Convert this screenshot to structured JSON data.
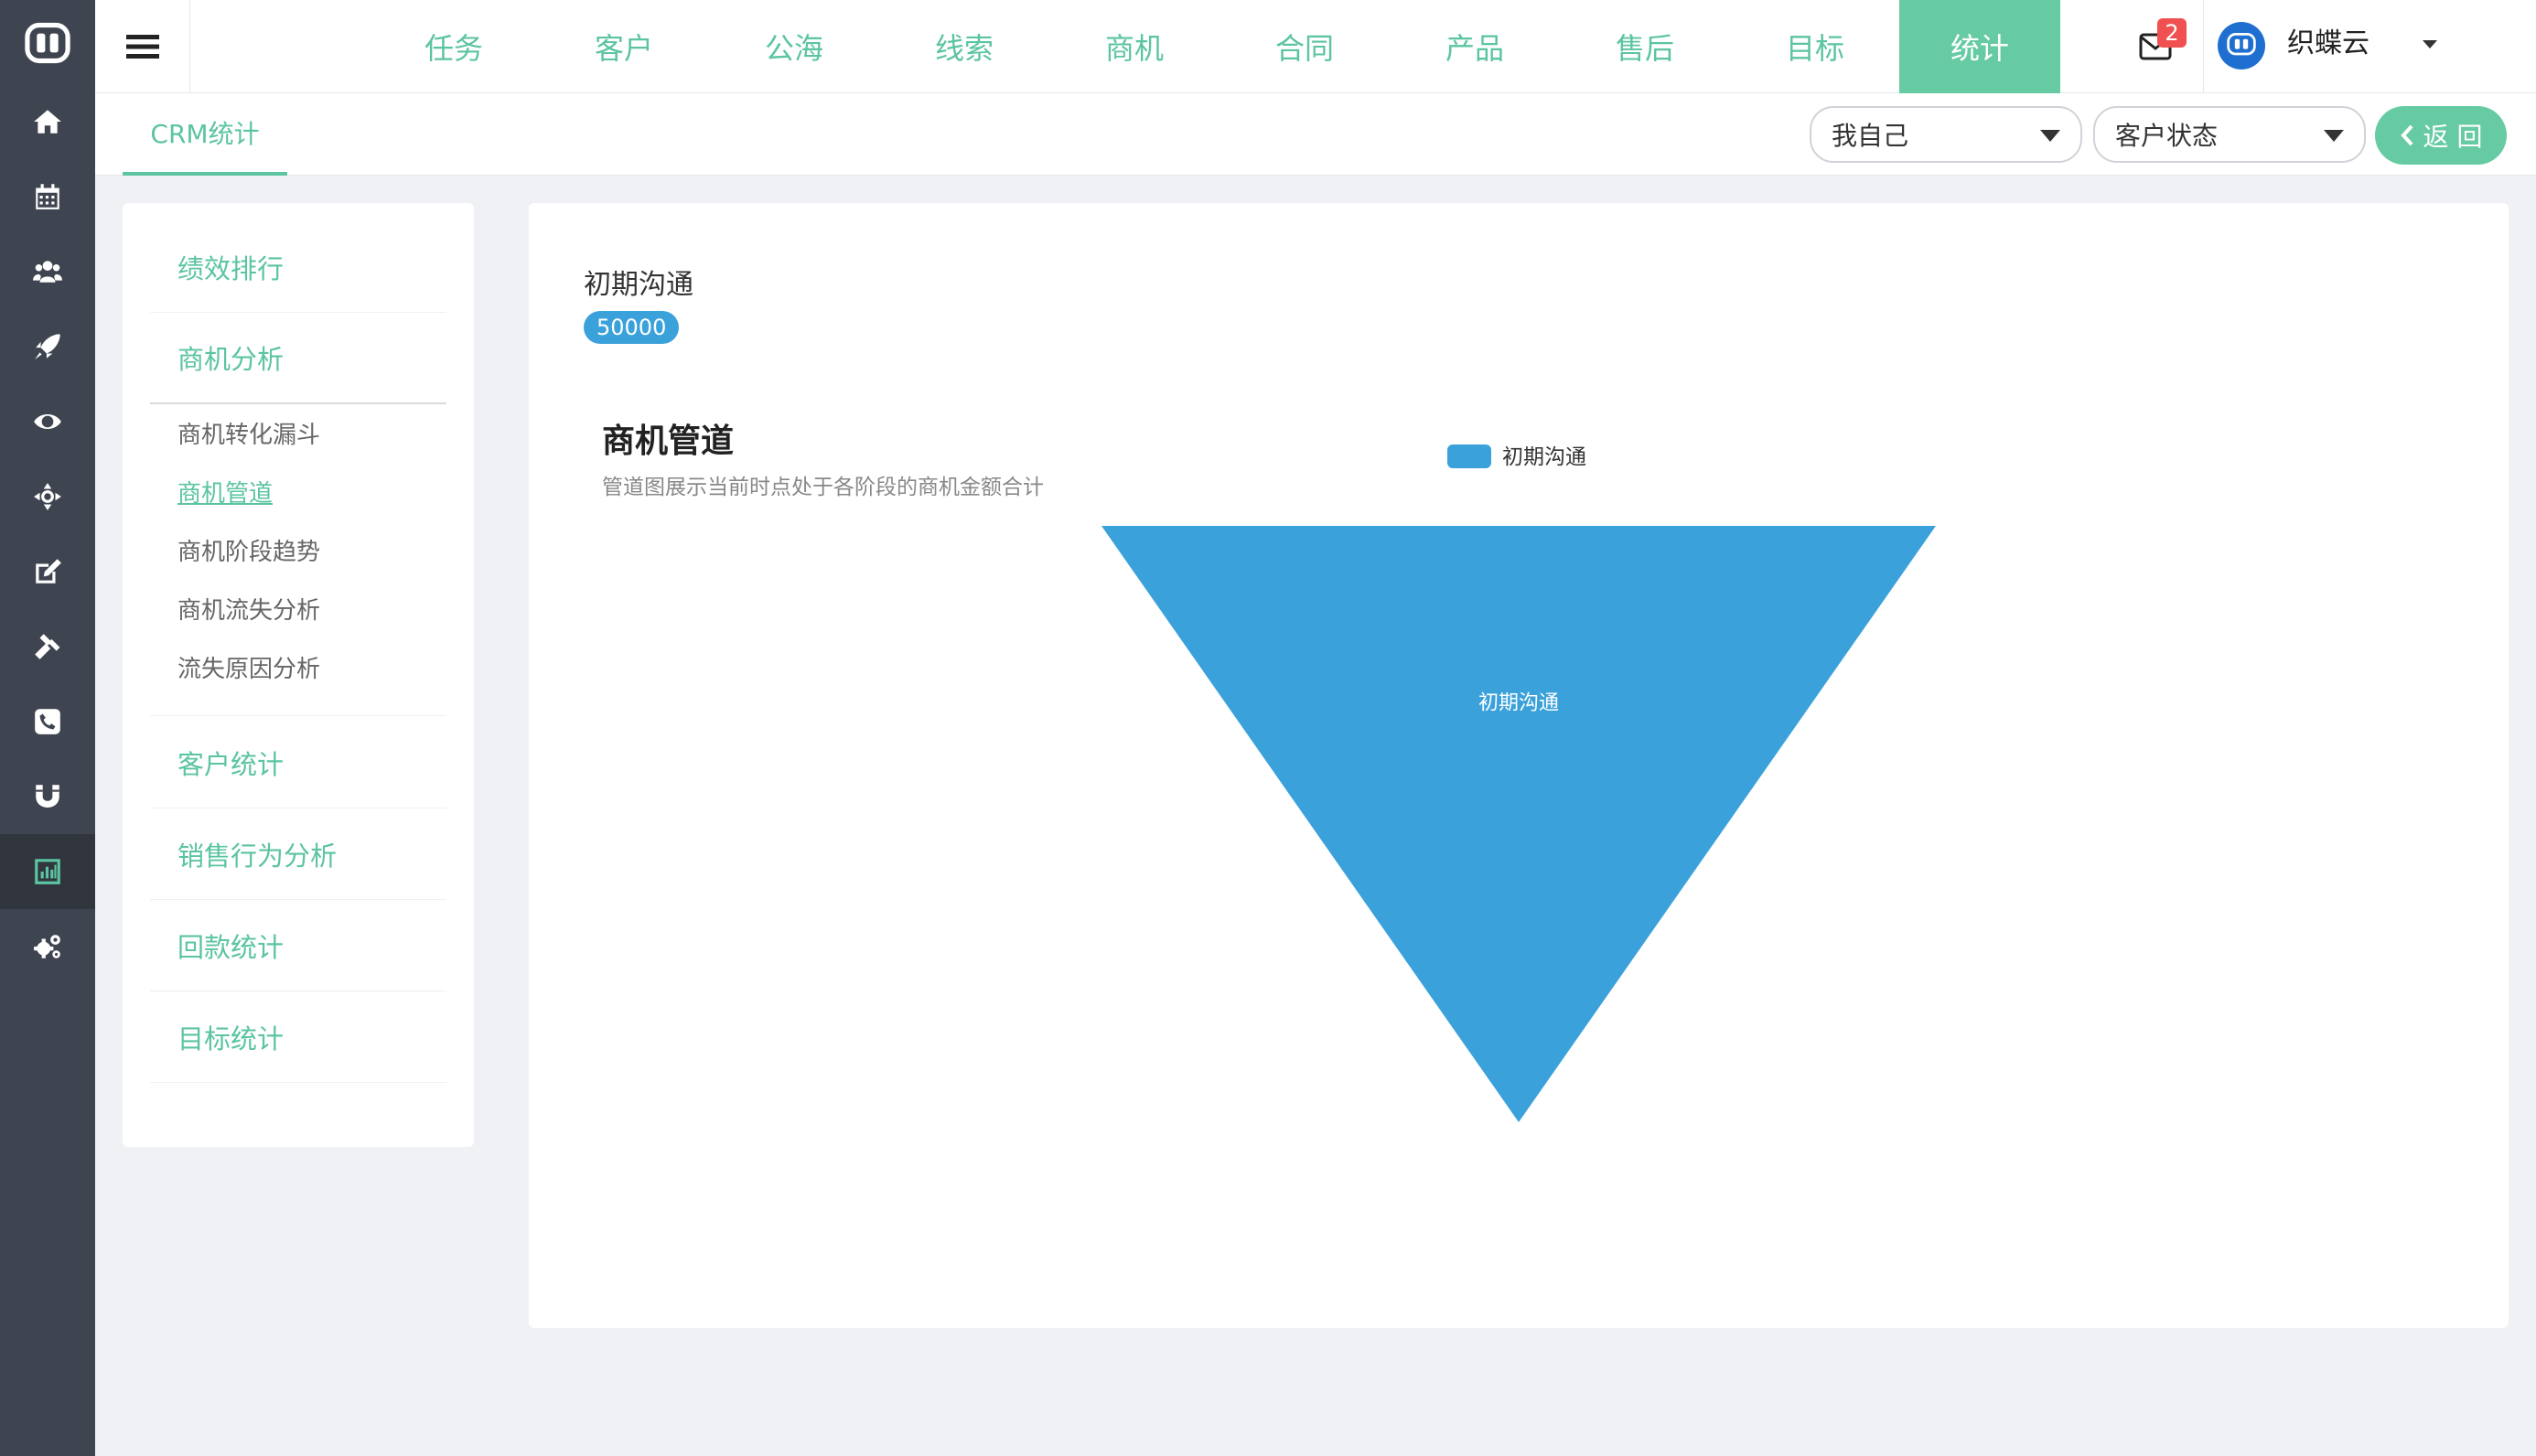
{
  "app": {
    "brand_icon": "app-logo-icon",
    "colors": {
      "accent": "#66cba3",
      "accent_text": "#5bc4a0",
      "chart_blue": "#3aa1da",
      "rail": "#3f4550",
      "badge": "#f05050"
    }
  },
  "rail": {
    "icons": [
      "home-icon",
      "calendar-icon",
      "users-icon",
      "rocket-icon",
      "eye-icon",
      "crosshair-icon",
      "edit-icon",
      "gavel-icon",
      "phone-icon",
      "magnet-icon",
      "bar-chart-icon",
      "cogs-icon"
    ],
    "active": "bar-chart-icon"
  },
  "nav": {
    "tabs": [
      "任务",
      "客户",
      "公海",
      "线索",
      "商机",
      "合同",
      "产品",
      "售后",
      "目标",
      "统计"
    ],
    "active": "统计"
  },
  "user": {
    "unread": "2",
    "name": "织蝶云"
  },
  "subbar": {
    "tab": "CRM统计",
    "scope_select": "我自己",
    "status_select": "客户状态",
    "back_label": "返 回"
  },
  "menu": {
    "groups": [
      "绩效排行",
      "商机分析",
      "客户统计",
      "销售行为分析",
      "回款统计",
      "目标统计"
    ],
    "submenu": [
      "商机转化漏斗",
      "商机管道",
      "商机阶段趋势",
      "商机流失分析",
      "流失原因分析"
    ],
    "active_sub": "商机管道"
  },
  "summary": {
    "stage": "初期沟通",
    "amount": "50000"
  },
  "chart_data": {
    "type": "funnel",
    "title": "商机管道",
    "subtitle": "管道图展示当前时点处于各阶段的商机金额合计",
    "legend": [
      "初期沟通"
    ],
    "legend_position": "top-center",
    "stages": [
      {
        "name": "初期沟通",
        "value": 50000
      }
    ],
    "color": "#3aa1da"
  }
}
